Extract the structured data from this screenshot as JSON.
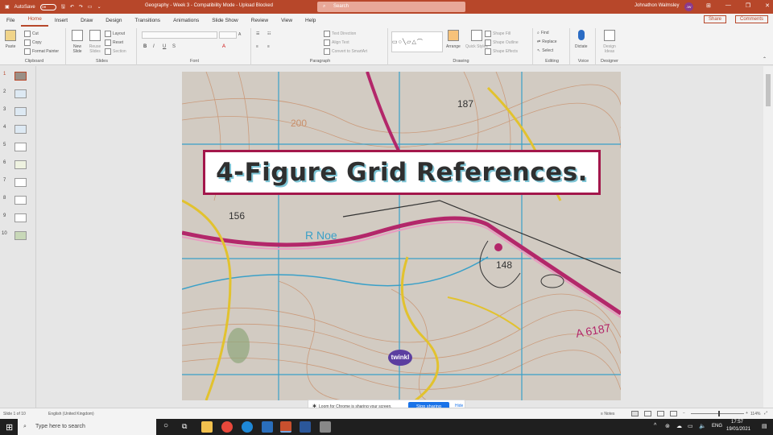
{
  "window": {
    "autosave_label": "AutoSave",
    "autosave_state": "Off",
    "doc_title": "Geography - Week 3  -  Compatibility Mode  -  Upload Blocked",
    "search_placeholder": "Search",
    "user_name": "Johnathon Walmsley",
    "user_initials": "JW"
  },
  "tabs": [
    "File",
    "Home",
    "Insert",
    "Draw",
    "Design",
    "Transitions",
    "Animations",
    "Slide Show",
    "Review",
    "View",
    "Help"
  ],
  "active_tab": "Home",
  "share_label": "Share",
  "comments_label": "Comments",
  "ribbon": {
    "clipboard": {
      "label": "Clipboard",
      "paste": "Paste",
      "cut": "Cut",
      "copy": "Copy",
      "format_painter": "Format Painter"
    },
    "slides": {
      "label": "Slides",
      "new_slide": "New Slide",
      "reuse": "Reuse Slides",
      "layout": "Layout",
      "reset": "Reset",
      "section": "Section"
    },
    "font": {
      "label": "Font"
    },
    "paragraph": {
      "label": "Paragraph",
      "text_direction": "Text Direction",
      "align_text": "Align Text",
      "smartart": "Convert to SmartArt"
    },
    "drawing": {
      "label": "Drawing",
      "arrange": "Arrange",
      "quick_styles": "Quick Styles",
      "shape_fill": "Shape Fill",
      "shape_outline": "Shape Outline",
      "shape_effects": "Shape Effects"
    },
    "editing": {
      "label": "Editing",
      "find": "Find",
      "replace": "Replace",
      "select": "Select"
    },
    "voice": {
      "label": "Voice",
      "dictate": "Dictate"
    },
    "designer": {
      "label": "Designer",
      "design_ideas": "Design Ideas"
    }
  },
  "slides_count": 10,
  "current_slide": 1,
  "slide": {
    "title": "4-Figure Grid References.",
    "logo": "twinkl",
    "map_labels": [
      "187",
      "200",
      "156",
      "R Noe",
      "148",
      "A 6187"
    ]
  },
  "loom": {
    "message": "Loom for Chrome is sharing your screen.",
    "stop_label": "Stop sharing",
    "hide_label": "Hide"
  },
  "status": {
    "slide_info": "Slide 1 of 10",
    "language": "English (United Kingdom)",
    "notes": "Notes",
    "zoom": "114%"
  },
  "taskbar": {
    "search_placeholder": "Type here to search",
    "language": "ENG",
    "time": "17:57",
    "date": "19/01/2021"
  },
  "colors": {
    "accent": "#b7472a",
    "title_border": "#a3174b",
    "title_shadow": "#7ec5d6"
  }
}
